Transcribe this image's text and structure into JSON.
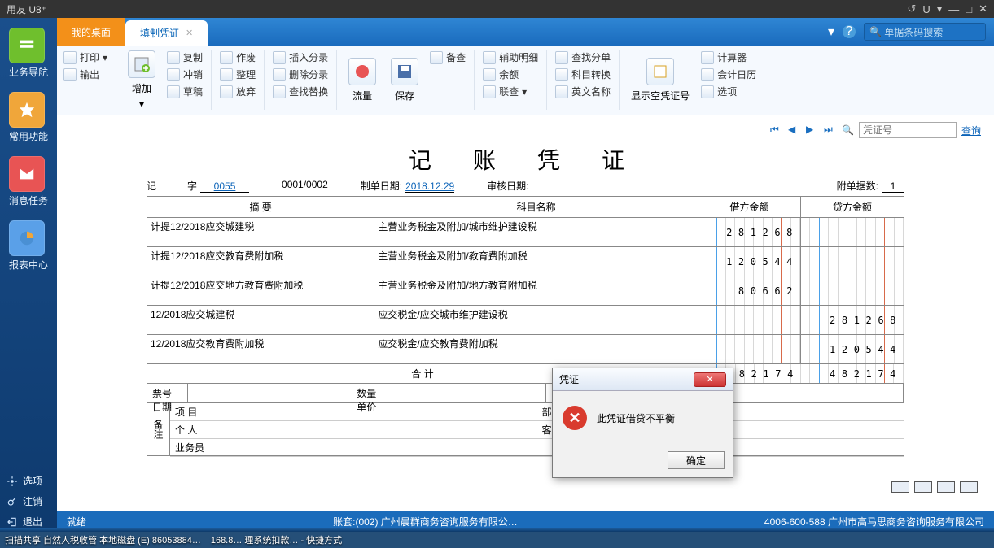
{
  "app_title": "用友 U8⁺",
  "titlectl": {
    "undo": "↺",
    "u": "U",
    "drop": "▾",
    "min": "—",
    "max": "□",
    "close": "✕"
  },
  "leftbar": {
    "items": [
      {
        "label": "业务导航",
        "color": "#6fbf2d"
      },
      {
        "label": "常用功能",
        "color": "#f0a63a"
      },
      {
        "label": "消息任务",
        "color": "#e85454"
      },
      {
        "label": "报表中心",
        "color": "#5aa0e8"
      }
    ],
    "bottom": [
      {
        "label": "选项",
        "icon": "gear"
      },
      {
        "label": "注销",
        "icon": "key"
      },
      {
        "label": "退出",
        "icon": "exit"
      }
    ]
  },
  "tabs": {
    "home": "我的桌面",
    "active": "填制凭证"
  },
  "tophead": {
    "help": "?",
    "drop": "▾",
    "search_placeholder": "单据条码搜索"
  },
  "ribbon": {
    "g1": [
      {
        "l": "打印",
        "d": true
      },
      {
        "l": "输出"
      }
    ],
    "big1": "增加",
    "g2": [
      {
        "l": "复制"
      },
      {
        "l": "冲销"
      },
      {
        "l": "草稿"
      }
    ],
    "g3": [
      {
        "l": "作废"
      },
      {
        "l": "整理"
      },
      {
        "l": "放弃"
      }
    ],
    "g4": [
      {
        "l": "插入分录"
      },
      {
        "l": "删除分录"
      },
      {
        "l": "查找替换"
      }
    ],
    "big2": "流量",
    "big3": "保存",
    "g5": [
      {
        "l": "备查"
      }
    ],
    "g6": [
      {
        "l": "辅助明细"
      },
      {
        "l": "余额"
      },
      {
        "l": "联查",
        "d": true
      }
    ],
    "g7": [
      {
        "l": "查找分单"
      },
      {
        "l": "科目转换"
      },
      {
        "l": "英文名称"
      }
    ],
    "big4": "显示空凭证号",
    "g8": [
      {
        "l": "计算器"
      },
      {
        "l": "会计日历"
      },
      {
        "l": "选项"
      }
    ]
  },
  "nav": {
    "voucher_placeholder": "凭证号",
    "query": "查询"
  },
  "voucher": {
    "title": "记 账 凭 证",
    "ji": "记",
    "zi": "字",
    "no": "0055",
    "seq": "0001/0002",
    "makedate_l": "制单日期:",
    "makedate": "2018.12.29",
    "auditdate_l": "审核日期:",
    "auditdate": "",
    "attach_l": "附单据数:",
    "attach": "1",
    "headers": {
      "c1": "摘 要",
      "c2": "科目名称",
      "c3": "借方金额",
      "c4": "贷方金额"
    },
    "rows": [
      {
        "s": "计提12/2018应交城建税",
        "k": "主营业务税金及附加/城市维护建设税",
        "d": "281268",
        "c": ""
      },
      {
        "s": "计提12/2018应交教育费附加税",
        "k": "主营业务税金及附加/教育费附加税",
        "d": "120544",
        "c": ""
      },
      {
        "s": "计提12/2018应交地方教育费附加税",
        "k": "主营业务税金及附加/地方教育附加税",
        "d": "80662",
        "c": ""
      },
      {
        "s": "12/2018应交城建税",
        "k": "应交税金/应交城市维护建设税",
        "d": "",
        "c": "281268"
      },
      {
        "s": "12/2018应交教育费附加税",
        "k": "应交税金/应交教育费附加税",
        "d": "",
        "c": "120544"
      }
    ],
    "sum": {
      "l": "合 计",
      "d": "482174",
      "c": "482174"
    },
    "ftr1": {
      "pn": "票号",
      "rq": "日期",
      "sl": "数量",
      "dj": "单价"
    },
    "ftr2": {
      "bz": "备注",
      "xm": "项 目",
      "bm": "部 门",
      "gr": "个 人",
      "kh": "客 户",
      "ywy": "业务员"
    }
  },
  "statusbar": {
    "ready": "就绪",
    "book": "账套:(002) 广州晨群商务咨询服务有限公…",
    "phone": "4006-600-588 广州市高马思商务咨询服务有限公司"
  },
  "dialog": {
    "title": "凭证",
    "msg": "此凭证借贷不平衡",
    "ok": "确定"
  },
  "taskbar": {
    "a": "扫描共享  自然人税收管  本地磁盘 (E)   86053884…",
    "b": "168.8…  理系统扣款… - 快捷方式"
  }
}
